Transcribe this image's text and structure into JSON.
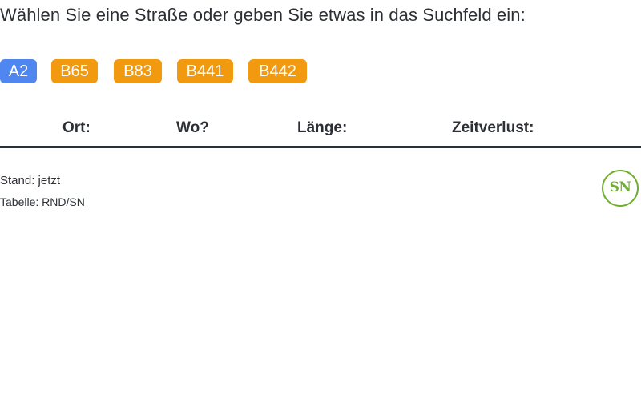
{
  "prompt": "Wählen Sie eine Straße oder geben Sie etwas in das Suchfeld ein:",
  "roads": [
    {
      "label": "A2",
      "color": "#4f86f0"
    },
    {
      "label": "B65",
      "color": "#f29a0f"
    },
    {
      "label": "B83",
      "color": "#f29a0f"
    },
    {
      "label": "B441",
      "color": "#f29a0f"
    },
    {
      "label": "B442",
      "color": "#f29a0f"
    }
  ],
  "table": {
    "headers": [
      "Ort:",
      "Wo?",
      "Länge:",
      "Zeitverlust:"
    ]
  },
  "footer": {
    "stand": "Stand: jetzt",
    "table_source": "Tabelle: RND/SN"
  },
  "logo": {
    "text": "SN",
    "color": "#6fae2f"
  }
}
